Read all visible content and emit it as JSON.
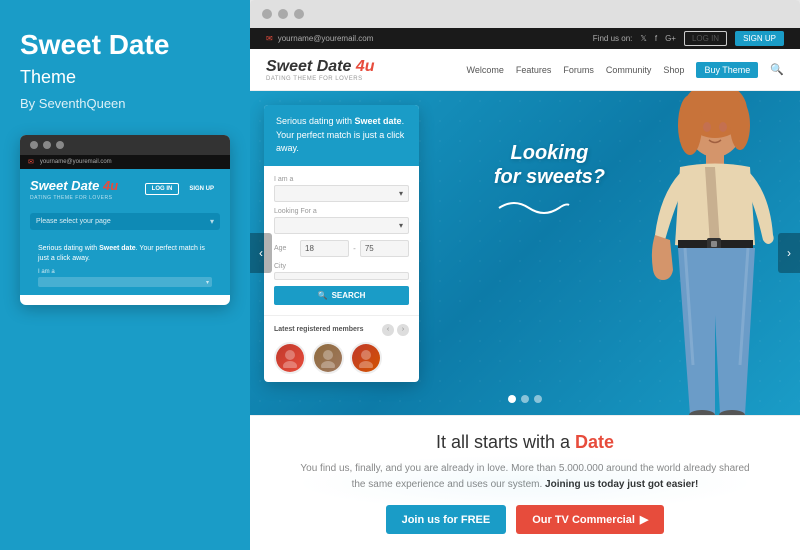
{
  "left_panel": {
    "title": "Sweet Date",
    "subtitle": "Theme",
    "author": "By SeventhQueen",
    "mini_browser": {
      "dots": [
        "dot1",
        "dot2",
        "dot3"
      ],
      "topbar_email": "yourname@youremail.com",
      "logo": "Sweet Date",
      "logo_number": "4u",
      "logo_sub": "DATING THEME FOR LOVERS",
      "btn_login": "LOG IN",
      "btn_signup": "SIGN UP",
      "select_placeholder": "Please select your page",
      "form_label": "I am a",
      "form_text": "Serious dating with Sweet date. Your perfect match is just a click away."
    }
  },
  "site": {
    "topbar": {
      "email": "yourname@youremail.com",
      "find_us": "Find us on:",
      "login": "LOG IN",
      "signup": "SIGN UP"
    },
    "nav": {
      "logo": "Sweet Date",
      "logo_number": "4u",
      "logo_sub": "DATING THEME FOR LOVERS",
      "links": [
        "Welcome",
        "Features",
        "Forums",
        "Community",
        "Shop"
      ],
      "buy_link": "Buy Theme",
      "btn_login": "LOG IN",
      "btn_signup": "SIGN UP"
    },
    "hero": {
      "form": {
        "title_part1": "Serious dating with ",
        "title_bold": "Sweet date",
        "title_part2": ". Your perfect match is just a click away.",
        "field1_label": "I am a",
        "field2_label": "Looking For a",
        "field3_label": "Age",
        "field3_from": "18",
        "field3_to": "75",
        "field4_label": "City",
        "search_btn": "SEARCH",
        "members_title": "Latest registered members"
      },
      "tagline_line1": "Looking",
      "tagline_line2": "for sweets?",
      "carousel_dots": [
        true,
        false,
        false
      ]
    },
    "bottom": {
      "title_part1": "It all starts with a ",
      "title_accent": "Date",
      "description": "You find us, finally, and you are already in love. More than 5.000.000 around the world already shared the same experience and uses our system.",
      "description_bold": "Joining us today just got easier!",
      "btn_free": "Join us for FREE",
      "btn_tv": "Our TV Commercial"
    }
  }
}
